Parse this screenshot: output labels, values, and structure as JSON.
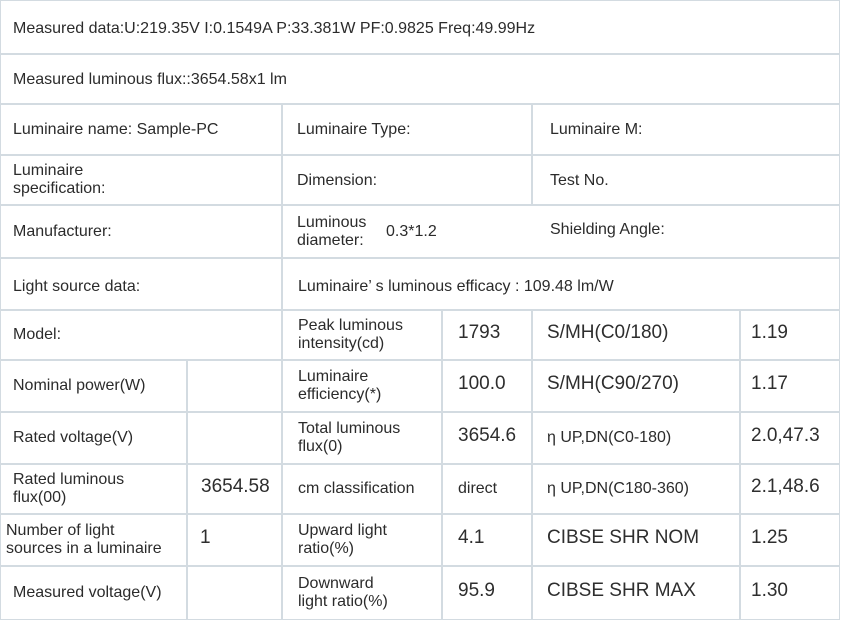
{
  "header": {
    "measured_data": "Measured data:U:219.35V I:0.1549A P:33.381W PF:0.9825 Freq:49.99Hz",
    "measured_flux": "Measured luminous flux::3654.58x1 lm"
  },
  "info": {
    "luminaire_name": "Luminaire name: Sample-PC",
    "luminaire_type": "Luminaire Type:",
    "luminaire_m": "Luminaire M:",
    "spec_line1": "Luminaire",
    "spec_line2": "specification:",
    "dimension": "Dimension:",
    "test_no": "Test No.",
    "manufacturer": "Manufacturer:",
    "lum_diam_line1": "Luminous",
    "lum_diam_line2": "diameter:",
    "lum_diam_value": "0.3*1.2",
    "shielding_angle": "Shielding Angle:",
    "light_source_data": "Light source data:",
    "efficacy": "Luminaire’ s  luminous efficacy : 109.48 lm/W"
  },
  "rows": [
    {
      "label1": "Model:",
      "label2": "",
      "value": "",
      "p_line1": "Peak luminous",
      "p_line2": "intensity(cd)",
      "p_value": "1793",
      "s_label": "S/MH(C0/180)",
      "s_value": "1.19"
    },
    {
      "label1": "Nominal power(W)",
      "label2": "",
      "value": "",
      "p_line1": "Luminaire",
      "p_line2": "efficiency(*)",
      "p_value": "100.0",
      "s_label": "S/MH(C90/270)",
      "s_value": "1.17"
    },
    {
      "label1": "Rated voltage(V)",
      "label2": "",
      "value": "",
      "p_line1": "Total luminous",
      "p_line2": "flux(0)",
      "p_value": "3654.6",
      "s_label": "η UP,DN(C0-180)",
      "s_value": "2.0,47.3"
    },
    {
      "label1": "Rated luminous",
      "label2": "flux(00)",
      "value": "3654.58",
      "p_line1": "cm classification",
      "p_line2": "",
      "p_value": "direct",
      "s_label": "η UP,DN(C180-360)",
      "s_value": "2.1,48.6"
    },
    {
      "label1": "Number of light",
      "label2": "sources in a luminaire",
      "value": "1",
      "p_line1": "Upward light",
      "p_line2": "ratio(%)",
      "p_value": "4.1",
      "s_label": "CIBSE SHR NOM",
      "s_value": "1.25"
    },
    {
      "label1": "Measured voltage(V)",
      "label2": "",
      "value": "",
      "p_line1": "Downward",
      "p_line2": "light ratio(%)",
      "p_value": "95.9",
      "s_label": "CIBSE SHR MAX",
      "s_value": "1.30"
    }
  ]
}
